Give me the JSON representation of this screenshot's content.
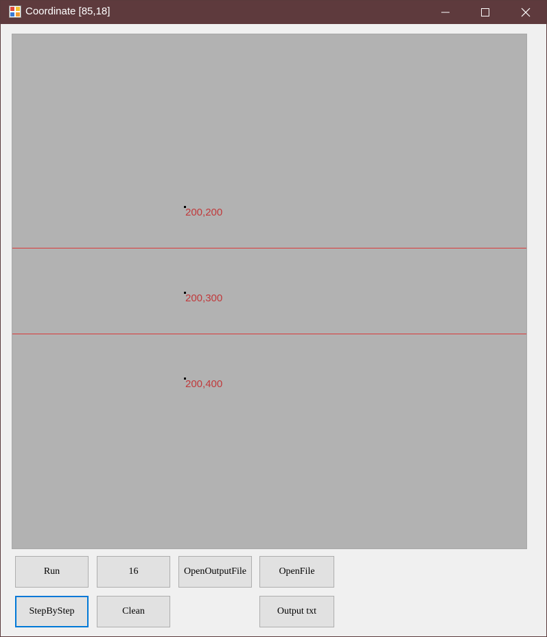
{
  "window": {
    "title": "Coordinate [85,18]"
  },
  "canvas": {
    "background": "#b2b2b2",
    "line_color": "#d83a3a",
    "label_color": "#c0393b",
    "points": [
      {
        "label": "200,200"
      },
      {
        "label": "200,300"
      },
      {
        "label": "200,400"
      }
    ]
  },
  "buttons": {
    "run": "Run",
    "number": "16",
    "open_output_file": "OpenOutputFile",
    "open_file": "OpenFile",
    "step_by_step": "StepByStep",
    "clean": "Clean",
    "output_txt": "Output txt"
  }
}
